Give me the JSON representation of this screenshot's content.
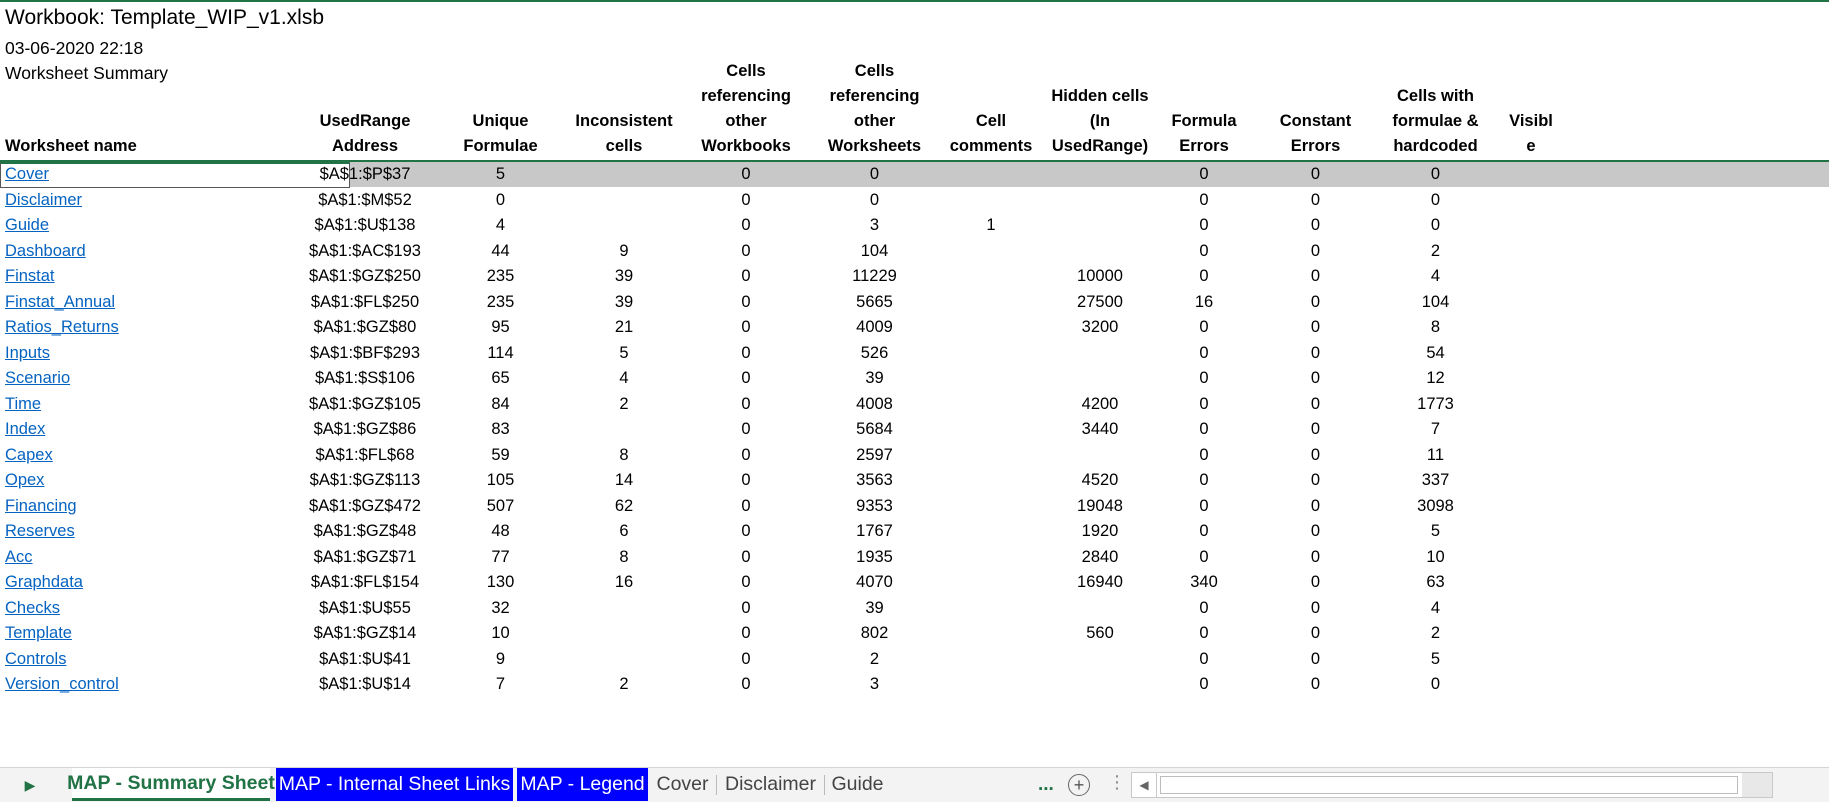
{
  "header": {
    "title": "Workbook: Template_WIP_v1.xlsb",
    "date": "03-06-2020 22:18",
    "summary": "Worksheet Summary"
  },
  "columns": [
    {
      "key": "name",
      "lines": [
        "Worksheet name"
      ]
    },
    {
      "key": "range",
      "lines": [
        "UsedRange",
        "Address"
      ]
    },
    {
      "key": "unique",
      "lines": [
        "Unique Formulae"
      ]
    },
    {
      "key": "inconsistent",
      "lines": [
        "Inconsistent",
        "cells"
      ]
    },
    {
      "key": "other_wb",
      "lines": [
        "Cells referencing",
        "other Workbooks"
      ]
    },
    {
      "key": "other_ws",
      "lines": [
        "Cells referencing",
        "other",
        "Worksheets"
      ]
    },
    {
      "key": "comments",
      "lines": [
        "Cell",
        "comments"
      ]
    },
    {
      "key": "hidden",
      "lines": [
        "Hidden cells",
        "(In UsedRange)"
      ]
    },
    {
      "key": "formula_errors",
      "lines": [
        "Formula Errors"
      ]
    },
    {
      "key": "constant_errors",
      "lines": [
        "Constant Errors"
      ]
    },
    {
      "key": "hardcoded",
      "lines": [
        "Cells with",
        "formulae &",
        "hardcoded"
      ]
    },
    {
      "key": "visible",
      "lines": [
        "Visibl",
        "e"
      ]
    }
  ],
  "rows": [
    {
      "name": "Cover",
      "range": "$A$1:$P$37",
      "unique": "5",
      "inconsistent": "",
      "other_wb": "0",
      "other_ws": "0",
      "comments": "",
      "hidden": "",
      "formula_errors": "0",
      "constant_errors": "0",
      "hardcoded": "0",
      "visible": ""
    },
    {
      "name": "Disclaimer",
      "range": "$A$1:$M$52",
      "unique": "0",
      "inconsistent": "",
      "other_wb": "0",
      "other_ws": "0",
      "comments": "",
      "hidden": "",
      "formula_errors": "0",
      "constant_errors": "0",
      "hardcoded": "0",
      "visible": ""
    },
    {
      "name": "Guide",
      "range": "$A$1:$U$138",
      "unique": "4",
      "inconsistent": "",
      "other_wb": "0",
      "other_ws": "3",
      "comments": "1",
      "hidden": "",
      "formula_errors": "0",
      "constant_errors": "0",
      "hardcoded": "0",
      "visible": ""
    },
    {
      "name": "Dashboard",
      "range": "$A$1:$AC$193",
      "unique": "44",
      "inconsistent": "9",
      "other_wb": "0",
      "other_ws": "104",
      "comments": "",
      "hidden": "",
      "formula_errors": "0",
      "constant_errors": "0",
      "hardcoded": "2",
      "visible": ""
    },
    {
      "name": "Finstat",
      "range": "$A$1:$GZ$250",
      "unique": "235",
      "inconsistent": "39",
      "other_wb": "0",
      "other_ws": "11229",
      "comments": "",
      "hidden": "10000",
      "formula_errors": "0",
      "constant_errors": "0",
      "hardcoded": "4",
      "visible": ""
    },
    {
      "name": "Finstat_Annual",
      "range": "$A$1:$FL$250",
      "unique": "235",
      "inconsistent": "39",
      "other_wb": "0",
      "other_ws": "5665",
      "comments": "",
      "hidden": "27500",
      "formula_errors": "16",
      "constant_errors": "0",
      "hardcoded": "104",
      "visible": ""
    },
    {
      "name": "Ratios_Returns",
      "range": "$A$1:$GZ$80",
      "unique": "95",
      "inconsistent": "21",
      "other_wb": "0",
      "other_ws": "4009",
      "comments": "",
      "hidden": "3200",
      "formula_errors": "0",
      "constant_errors": "0",
      "hardcoded": "8",
      "visible": ""
    },
    {
      "name": "Inputs",
      "range": "$A$1:$BF$293",
      "unique": "114",
      "inconsistent": "5",
      "other_wb": "0",
      "other_ws": "526",
      "comments": "",
      "hidden": "",
      "formula_errors": "0",
      "constant_errors": "0",
      "hardcoded": "54",
      "visible": ""
    },
    {
      "name": "Scenario",
      "range": "$A$1:$S$106",
      "unique": "65",
      "inconsistent": "4",
      "other_wb": "0",
      "other_ws": "39",
      "comments": "",
      "hidden": "",
      "formula_errors": "0",
      "constant_errors": "0",
      "hardcoded": "12",
      "visible": ""
    },
    {
      "name": "Time",
      "range": "$A$1:$GZ$105",
      "unique": "84",
      "inconsistent": "2",
      "other_wb": "0",
      "other_ws": "4008",
      "comments": "",
      "hidden": "4200",
      "formula_errors": "0",
      "constant_errors": "0",
      "hardcoded": "1773",
      "visible": ""
    },
    {
      "name": "Index",
      "range": "$A$1:$GZ$86",
      "unique": "83",
      "inconsistent": "",
      "other_wb": "0",
      "other_ws": "5684",
      "comments": "",
      "hidden": "3440",
      "formula_errors": "0",
      "constant_errors": "0",
      "hardcoded": "7",
      "visible": ""
    },
    {
      "name": "Capex",
      "range": "$A$1:$FL$68",
      "unique": "59",
      "inconsistent": "8",
      "other_wb": "0",
      "other_ws": "2597",
      "comments": "",
      "hidden": "",
      "formula_errors": "0",
      "constant_errors": "0",
      "hardcoded": "11",
      "visible": ""
    },
    {
      "name": "Opex",
      "range": "$A$1:$GZ$113",
      "unique": "105",
      "inconsistent": "14",
      "other_wb": "0",
      "other_ws": "3563",
      "comments": "",
      "hidden": "4520",
      "formula_errors": "0",
      "constant_errors": "0",
      "hardcoded": "337",
      "visible": ""
    },
    {
      "name": "Financing",
      "range": "$A$1:$GZ$472",
      "unique": "507",
      "inconsistent": "62",
      "other_wb": "0",
      "other_ws": "9353",
      "comments": "",
      "hidden": "19048",
      "formula_errors": "0",
      "constant_errors": "0",
      "hardcoded": "3098",
      "visible": ""
    },
    {
      "name": "Reserves",
      "range": "$A$1:$GZ$48",
      "unique": "48",
      "inconsistent": "6",
      "other_wb": "0",
      "other_ws": "1767",
      "comments": "",
      "hidden": "1920",
      "formula_errors": "0",
      "constant_errors": "0",
      "hardcoded": "5",
      "visible": ""
    },
    {
      "name": "Acc",
      "range": "$A$1:$GZ$71",
      "unique": "77",
      "inconsistent": "8",
      "other_wb": "0",
      "other_ws": "1935",
      "comments": "",
      "hidden": "2840",
      "formula_errors": "0",
      "constant_errors": "0",
      "hardcoded": "10",
      "visible": ""
    },
    {
      "name": "Graphdata",
      "range": "$A$1:$FL$154",
      "unique": "130",
      "inconsistent": "16",
      "other_wb": "0",
      "other_ws": "4070",
      "comments": "",
      "hidden": "16940",
      "formula_errors": "340",
      "constant_errors": "0",
      "hardcoded": "63",
      "visible": ""
    },
    {
      "name": "Checks",
      "range": "$A$1:$U$55",
      "unique": "32",
      "inconsistent": "",
      "other_wb": "0",
      "other_ws": "39",
      "comments": "",
      "hidden": "",
      "formula_errors": "0",
      "constant_errors": "0",
      "hardcoded": "4",
      "visible": ""
    },
    {
      "name": "Template",
      "range": "$A$1:$GZ$14",
      "unique": "10",
      "inconsistent": "",
      "other_wb": "0",
      "other_ws": "802",
      "comments": "",
      "hidden": "560",
      "formula_errors": "0",
      "constant_errors": "0",
      "hardcoded": "2",
      "visible": ""
    },
    {
      "name": "Controls",
      "range": "$A$1:$U$41",
      "unique": "9",
      "inconsistent": "",
      "other_wb": "0",
      "other_ws": "2",
      "comments": "",
      "hidden": "",
      "formula_errors": "0",
      "constant_errors": "0",
      "hardcoded": "5",
      "visible": ""
    },
    {
      "name": "Version_control",
      "range": "$A$1:$U$14",
      "unique": "7",
      "inconsistent": "2",
      "other_wb": "0",
      "other_ws": "3",
      "comments": "",
      "hidden": "",
      "formula_errors": "0",
      "constant_errors": "0",
      "hardcoded": "0",
      "visible": ""
    }
  ],
  "tabs": [
    {
      "label": "MAP - Summary Sheet",
      "style": "active"
    },
    {
      "label": "MAP  - Internal Sheet Links",
      "style": "blue"
    },
    {
      "label": "MAP - Legend",
      "style": "blue"
    },
    {
      "label": "Cover",
      "style": "plain"
    },
    {
      "label": "Disclaimer",
      "style": "plain"
    },
    {
      "label": "Guide",
      "style": "plain"
    }
  ],
  "tab_more": "...",
  "colors": {
    "accent": "#217346",
    "link": "#0563c1",
    "tab_blue": "#0000ff",
    "selection": "#c8c8c8"
  },
  "icons": {
    "nav": "play-right-icon",
    "add": "plus-circle-icon",
    "scroll_left": "caret-left-icon"
  }
}
